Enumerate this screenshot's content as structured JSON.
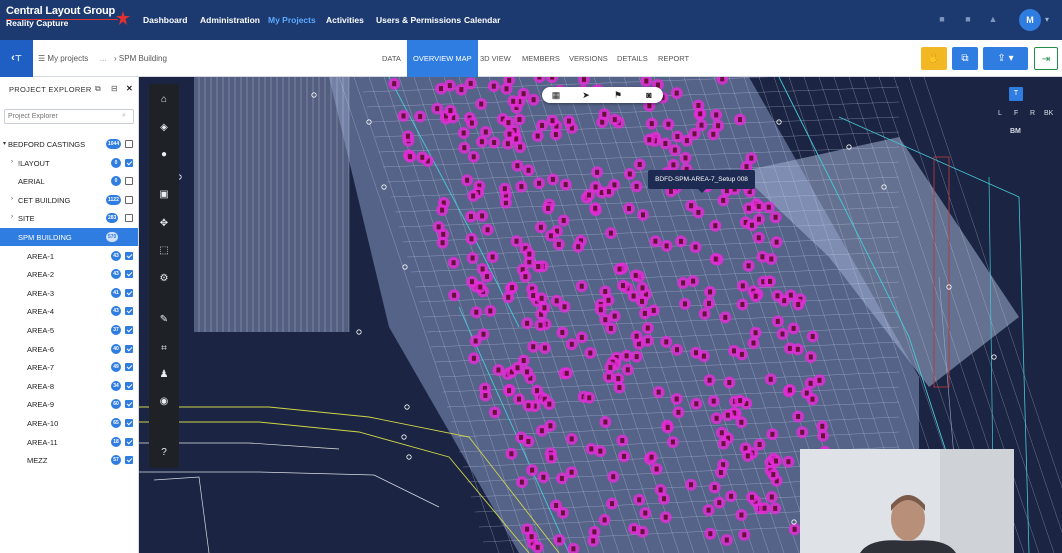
{
  "app": {
    "brand_line1": "Central Layout Group",
    "brand_line2": "Reality Capture"
  },
  "nav": {
    "items": [
      "Dashboard",
      "Administration",
      "My Projects",
      "Activities",
      "Users & Permissions",
      "Calendar"
    ],
    "active": "My Projects",
    "user_initial": "M"
  },
  "breadcrumb": {
    "root": "My projects",
    "sep": "...",
    "current": "SPM Building"
  },
  "tabs": [
    "DATA",
    "OVERVIEW MAP",
    "3D VIEW",
    "MEMBERS",
    "VERSIONS",
    "DETAILS",
    "REPORT"
  ],
  "active_tab": "OVERVIEW MAP",
  "explorer": {
    "title": "PROJECT EXPLORER",
    "search_placeholder": "Project Explorer",
    "items": [
      {
        "name": "BEDFORD CASTINGS",
        "badge": "1044",
        "level": 0,
        "caret": "▾",
        "checked": false,
        "selected": false
      },
      {
        "name": "!LAYOUT",
        "badge": "0",
        "level": 1,
        "caret": "›",
        "checked": true,
        "selected": false
      },
      {
        "name": "AERIAL",
        "badge": "0",
        "level": 1,
        "caret": "",
        "checked": false,
        "selected": false
      },
      {
        "name": "CET BUILDING",
        "badge": "1122",
        "level": 1,
        "caret": "›",
        "checked": false,
        "selected": false
      },
      {
        "name": "SITE",
        "badge": "283",
        "level": 1,
        "caret": "›",
        "checked": false,
        "selected": false
      },
      {
        "name": "SPM BUILDING",
        "badge": "570",
        "level": 1,
        "caret": "",
        "checked": false,
        "selected": true
      },
      {
        "name": "AREA-1",
        "badge": "43",
        "level": 2,
        "caret": "",
        "checked": true,
        "selected": false
      },
      {
        "name": "AREA-2",
        "badge": "43",
        "level": 2,
        "caret": "",
        "checked": true,
        "selected": false
      },
      {
        "name": "AREA-3",
        "badge": "41",
        "level": 2,
        "caret": "",
        "checked": true,
        "selected": false
      },
      {
        "name": "AREA-4",
        "badge": "43",
        "level": 2,
        "caret": "",
        "checked": true,
        "selected": false
      },
      {
        "name": "AREA-5",
        "badge": "37",
        "level": 2,
        "caret": "",
        "checked": true,
        "selected": false
      },
      {
        "name": "AREA-6",
        "badge": "40",
        "level": 2,
        "caret": "",
        "checked": true,
        "selected": false
      },
      {
        "name": "AREA-7",
        "badge": "49",
        "level": 2,
        "caret": "",
        "checked": true,
        "selected": false
      },
      {
        "name": "AREA-8",
        "badge": "34",
        "level": 2,
        "caret": "",
        "checked": true,
        "selected": false
      },
      {
        "name": "AREA-9",
        "badge": "60",
        "level": 2,
        "caret": "",
        "checked": true,
        "selected": false
      },
      {
        "name": "AREA-10",
        "badge": "65",
        "level": 2,
        "caret": "",
        "checked": true,
        "selected": false
      },
      {
        "name": "AREA-11",
        "badge": "18",
        "level": 2,
        "caret": "",
        "checked": true,
        "selected": false
      },
      {
        "name": "MEZZ",
        "badge": "57",
        "level": 2,
        "caret": "",
        "checked": true,
        "selected": false
      }
    ]
  },
  "map": {
    "tooltip": "BDFD-SPM-AREA-7_Setup 008"
  },
  "viewcube": {
    "top": "T",
    "faces": [
      "L",
      "F",
      "R",
      "BK"
    ],
    "bottom": "BM"
  },
  "colors": {
    "nav_bg": "#1c3a70",
    "accent": "#2f7de0",
    "marker": "#e62bd8",
    "map_bg": "#1b2442",
    "btn_yellow": "#f2b824",
    "btn_green": "#1f8f4a"
  }
}
